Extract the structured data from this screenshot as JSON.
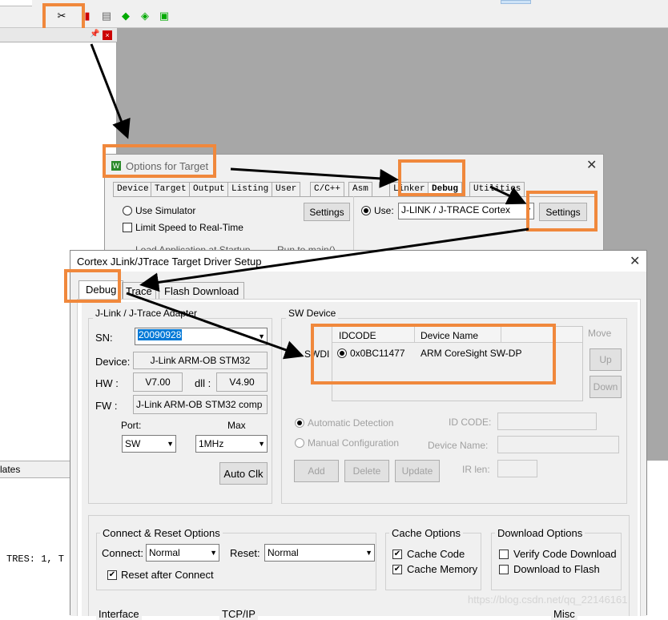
{
  "bottom": {
    "tab_label": "lates",
    "output_text": "TRES: 1, T"
  },
  "options_dialog": {
    "title": "Options for Target",
    "tabs": [
      "Device",
      "Target",
      "Output",
      "Listing",
      "User",
      "C/C++",
      "Asm",
      "Linker",
      "Debug",
      "Utilities"
    ],
    "use_simulator": "Use Simulator",
    "limit_speed": "Limit Speed to Real-Time",
    "settings_label": "Settings",
    "use_label": "Use:",
    "debugger": "J-LINK / J-TRACE Cortex",
    "load_app": "Load Application at Startup",
    "run_to_main": "Run to main()"
  },
  "setup_dialog": {
    "title": "Cortex JLink/JTrace Target Driver Setup",
    "tabs": [
      "Debug",
      "Trace",
      "Flash Download"
    ],
    "adapter": {
      "group_label": "J-Link / J-Trace Adapter",
      "sn_label": "SN:",
      "sn_value": "20090928",
      "device_label": "Device:",
      "device_value": "J-Link ARM-OB STM32",
      "hw_label": "HW :",
      "hw_value": "V7.00",
      "dll_label": "dll :",
      "dll_value": "V4.90",
      "fw_label": "FW :",
      "fw_value": "J-Link ARM-OB STM32 comp",
      "port_label": "Port:",
      "port_value": "SW",
      "max_label": "Max",
      "max_value": "1MHz",
      "auto_clk": "Auto Clk"
    },
    "sw_device": {
      "group_label": "SW Device",
      "col_idcode": "IDCODE",
      "col_name": "Device Name",
      "row_label": "SWDI",
      "row_idcode": "0x0BC11477",
      "row_name": "ARM CoreSight SW-DP",
      "move": "Move",
      "up": "Up",
      "down": "Down",
      "auto_detect": "Automatic Detection",
      "manual_config": "Manual Configuration",
      "id_code": "ID CODE:",
      "device_name": "Device Name:",
      "ir_len": "IR len:",
      "add": "Add",
      "delete": "Delete",
      "update": "Update"
    },
    "connect_reset": {
      "group_label": "Connect & Reset Options",
      "connect_label": "Connect:",
      "connect_value": "Normal",
      "reset_label": "Reset:",
      "reset_value": "Normal",
      "reset_after": "Reset after Connect"
    },
    "cache": {
      "group_label": "Cache Options",
      "cache_code": "Cache Code",
      "cache_memory": "Cache Memory"
    },
    "download": {
      "group_label": "Download Options",
      "verify": "Verify Code Download",
      "to_flash": "Download to Flash"
    },
    "interface_label": "Interface",
    "tcpip_label": "TCP/IP",
    "misc_label": "Misc"
  },
  "watermark": "https://blog.csdn.net/qq_22146161",
  "colors": {
    "highlight": "#f0883c",
    "arrow": "#000000"
  }
}
